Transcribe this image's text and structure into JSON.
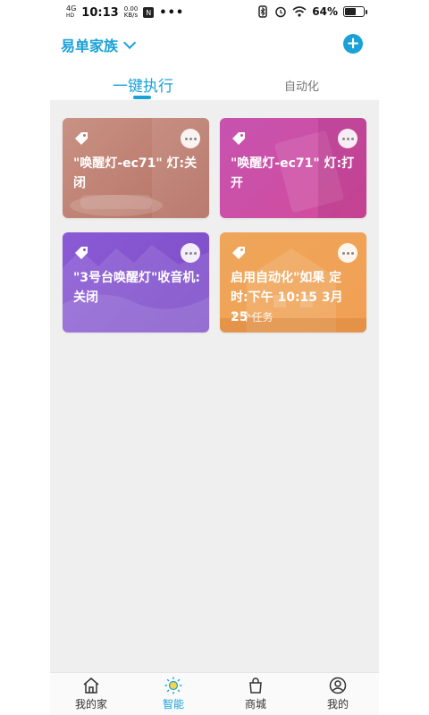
{
  "status_bar": {
    "network": "4G",
    "network_sub": "HD",
    "time": "10:13",
    "speed_value": "0.00",
    "speed_unit": "KB/s",
    "notif_icon": "N",
    "overflow_dots": "•••",
    "battery_percent": "64%",
    "battery_level": 0.64
  },
  "header": {
    "home_name": "易单家族",
    "add_symbol": "+"
  },
  "tabs": [
    {
      "label": "一键执行",
      "active": true
    },
    {
      "label": "自动化",
      "active": false
    }
  ],
  "cards": [
    {
      "title": "\"唤醒灯-ec71\" 灯:关闭",
      "subtitle": ""
    },
    {
      "title": "\"唤醒灯-ec71\" 灯:打开",
      "subtitle": ""
    },
    {
      "title": "\"3号台唤醒灯\"收音机:关闭",
      "subtitle": ""
    },
    {
      "title": "启用自动化\"如果 定时:下午 10:15 3月25",
      "subtitle": "1 个任务"
    }
  ],
  "bottom_nav": [
    {
      "label": "我的家",
      "icon": "home-icon",
      "active": false
    },
    {
      "label": "智能",
      "icon": "sun-icon",
      "active": true
    },
    {
      "label": "商城",
      "icon": "bag-icon",
      "active": false
    },
    {
      "label": "我的",
      "icon": "user-icon",
      "active": false
    }
  ],
  "colors": {
    "accent": "#1aa2d8",
    "card1": "#b9786a",
    "card2": "#cf4fa3",
    "card3": "#834fd0",
    "card4": "#f0a256"
  }
}
